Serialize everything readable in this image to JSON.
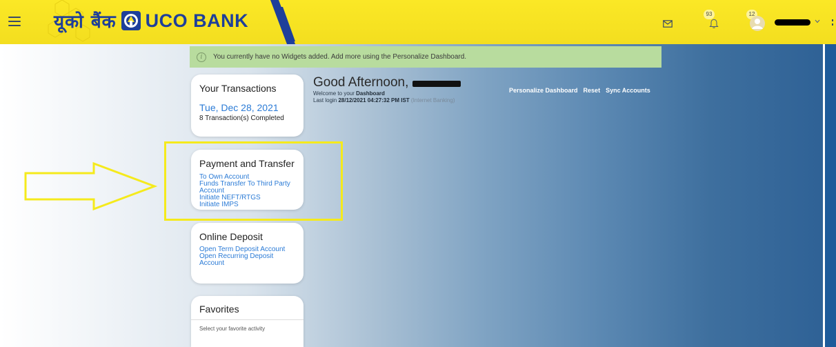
{
  "header": {
    "logo_hindi": "यूको बैंक",
    "logo_english": "UCO BANK",
    "notifications_count": "93",
    "profile_count": "12",
    "colors": {
      "bar": "#f7e22a",
      "brand_blue": "#1e3f9a"
    }
  },
  "info_bar": {
    "text": "You currently have no Widgets added. Add more using the Personalize Dashboard."
  },
  "cards": {
    "transactions": {
      "title": "Your Transactions",
      "date": "Tue, Dec 28, 2021",
      "count_text": "8 Transaction(s) Completed"
    },
    "payment": {
      "title": "Payment and Transfer",
      "links": [
        "To Own Account",
        "Funds Transfer To Third Party Account",
        "Initiate NEFT/RTGS",
        "Initiate IMPS"
      ]
    },
    "deposit": {
      "title": "Online Deposit",
      "links": [
        "Open Term Deposit Account",
        "Open Recurring Deposit Account"
      ]
    },
    "favorites": {
      "title": "Favorites",
      "hint": "Select your favorite activity"
    }
  },
  "greeting": {
    "text": "Good Afternoon,",
    "welcome_prefix": "Welcome to your",
    "welcome_bold": "Dashboard",
    "last_login_label": "Last login",
    "last_login_value": "28/12/2021 04:27:32 PM IST",
    "last_login_channel": "(Internet Banking)"
  },
  "dashboard_actions": {
    "personalize": "Personalize Dashboard",
    "reset": "Reset",
    "sync": "Sync Accounts"
  },
  "icons": [
    "menu-icon",
    "mail-icon",
    "bell-icon",
    "avatar-icon",
    "chevron-down-icon",
    "info-icon",
    "arrow-annotation"
  ]
}
